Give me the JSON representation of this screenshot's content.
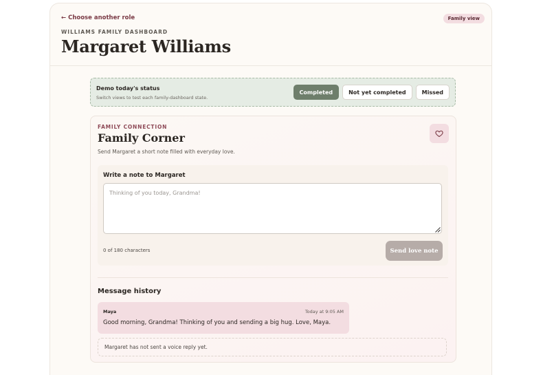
{
  "header": {
    "back_link": "← Choose another role",
    "eyebrow": "WILLIAMS FAMILY DASHBOARD",
    "title": "Margaret Williams",
    "view_badge": "Family view"
  },
  "demo": {
    "title": "Demo today's status",
    "subtitle": "Switch views to test each family-dashboard state.",
    "buttons": [
      {
        "label": "Completed",
        "active": true
      },
      {
        "label": "Not yet completed",
        "active": false
      },
      {
        "label": "Missed",
        "active": false
      }
    ]
  },
  "family_corner": {
    "eyebrow": "FAMILY CONNECTION",
    "title": "Family Corner",
    "subtitle": "Send Margaret a short note filled with everyday love.",
    "heart_icon": "heart-icon",
    "note": {
      "label": "Write a note to Margaret",
      "placeholder": "Thinking of you today, Grandma!",
      "value": "",
      "char_count": "0 of 180 characters",
      "send_label": "Send love note"
    },
    "history": {
      "title": "Message history",
      "messages": [
        {
          "author": "Maya",
          "time": "Today at 9:05 AM",
          "text": "Good morning, Grandma! Thinking of you and sending a big hug. Love, Maya."
        }
      ],
      "voice_status": "Margaret has not sent a voice reply yet."
    }
  },
  "colors": {
    "accent": "#7a3a45",
    "active_button": "#6e7e6b",
    "message_bg": "#f3dde1",
    "demo_bg": "#e5ece4"
  }
}
